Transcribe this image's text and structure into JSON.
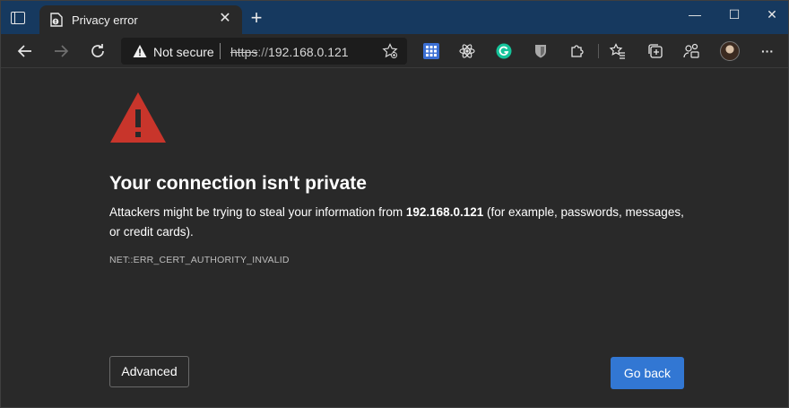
{
  "browser": {
    "tab": {
      "title": "Privacy error",
      "close_icon": "close-icon",
      "favicon": "document-warning-icon"
    },
    "new_tab_label": "+",
    "window_controls": {
      "minimize": "—",
      "maximize": "☐",
      "close": "✕"
    },
    "toolbar": {
      "back_icon": "back-arrow-icon",
      "forward_icon": "forward-arrow-icon",
      "refresh_icon": "refresh-icon",
      "security_label": "Not secure",
      "url_scheme": "https",
      "url_separator": "://",
      "url_host": "192.168.0.121",
      "extensions": [
        "apps-grid-icon",
        "react-devtools-icon",
        "grammarly-icon",
        "bitwarden-icon",
        "extensions-puzzle-icon"
      ],
      "favorites_icon": "favorites-icon",
      "collections_icon": "collections-icon",
      "profile_switch_icon": "profiles-icon",
      "menu_label": "···"
    }
  },
  "page": {
    "heading": "Your connection isn't private",
    "body_prefix": "Attackers might be trying to steal your information from ",
    "body_host": "192.168.0.121",
    "body_suffix": " (for example, passwords, messages, or credit cards).",
    "error_code": "NET::ERR_CERT_AUTHORITY_INVALID",
    "advanced_label": "Advanced",
    "go_back_label": "Go back"
  },
  "colors": {
    "titlebar": "#16395f",
    "background": "#292929",
    "warning_red": "#c8352b",
    "primary_button": "#3277d3"
  }
}
